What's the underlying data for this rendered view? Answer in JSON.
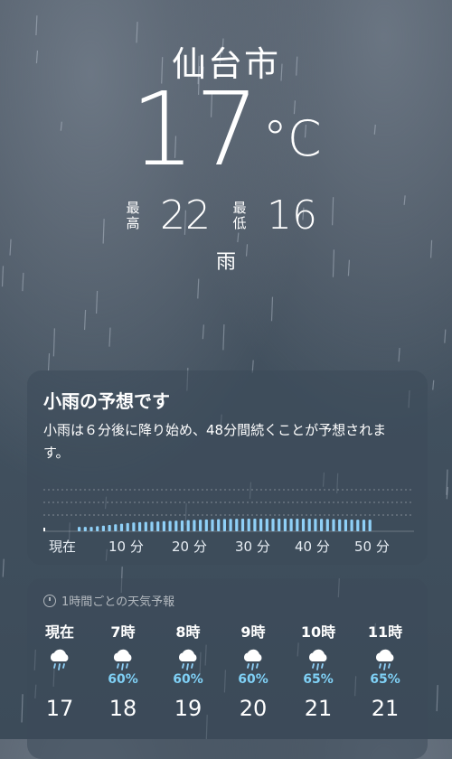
{
  "location": {
    "city": "仙台市"
  },
  "current": {
    "temperature": "17",
    "unit": "°C",
    "high_label": "最高",
    "high": "22",
    "low_label": "最低",
    "low": "16",
    "condition": "雨"
  },
  "precip_card": {
    "title": "小雨の予想です",
    "description": "小雨は６分後に降り始め、48分間続くことが予想されます。",
    "time_labels": [
      "現在",
      "10 分",
      "20 分",
      "30 分",
      "40 分",
      "50 分"
    ],
    "chart_data": {
      "type": "bar",
      "x_unit": "分",
      "intensity": [
        0.35,
        0.35,
        0.35,
        0.4,
        0.45,
        0.5,
        0.55,
        0.6,
        0.65,
        0.7,
        0.72,
        0.74,
        0.76,
        0.78,
        0.8,
        0.82,
        0.84,
        0.86,
        0.88,
        0.9,
        0.92,
        0.94,
        0.95,
        0.96,
        0.97,
        0.98,
        0.99,
        1.0,
        1.0,
        1.0,
        1.0,
        1.0,
        1.0,
        1.0,
        1.0,
        1.0,
        1.0,
        1.0,
        1.0,
        0.99,
        0.98,
        0.97,
        0.96,
        0.95,
        0.94,
        0.93,
        0.92,
        0.92,
        0.92
      ],
      "start_minute": 6
    },
    "accent_color": "#8fd0f7"
  },
  "hourly_card": {
    "header": "1時間ごとの天気予報",
    "hours": [
      {
        "time": "現在",
        "precip": "",
        "temp": "17",
        "icon": "rain-cloud-icon"
      },
      {
        "time": "7時",
        "precip": "60%",
        "temp": "18",
        "icon": "rain-cloud-icon"
      },
      {
        "time": "8時",
        "precip": "60%",
        "temp": "19",
        "icon": "rain-cloud-icon"
      },
      {
        "time": "9時",
        "precip": "60%",
        "temp": "20",
        "icon": "rain-cloud-icon"
      },
      {
        "time": "10時",
        "precip": "65%",
        "temp": "21",
        "icon": "rain-cloud-icon"
      },
      {
        "time": "11時",
        "precip": "65%",
        "temp": "21",
        "icon": "rain-cloud-icon"
      }
    ]
  }
}
